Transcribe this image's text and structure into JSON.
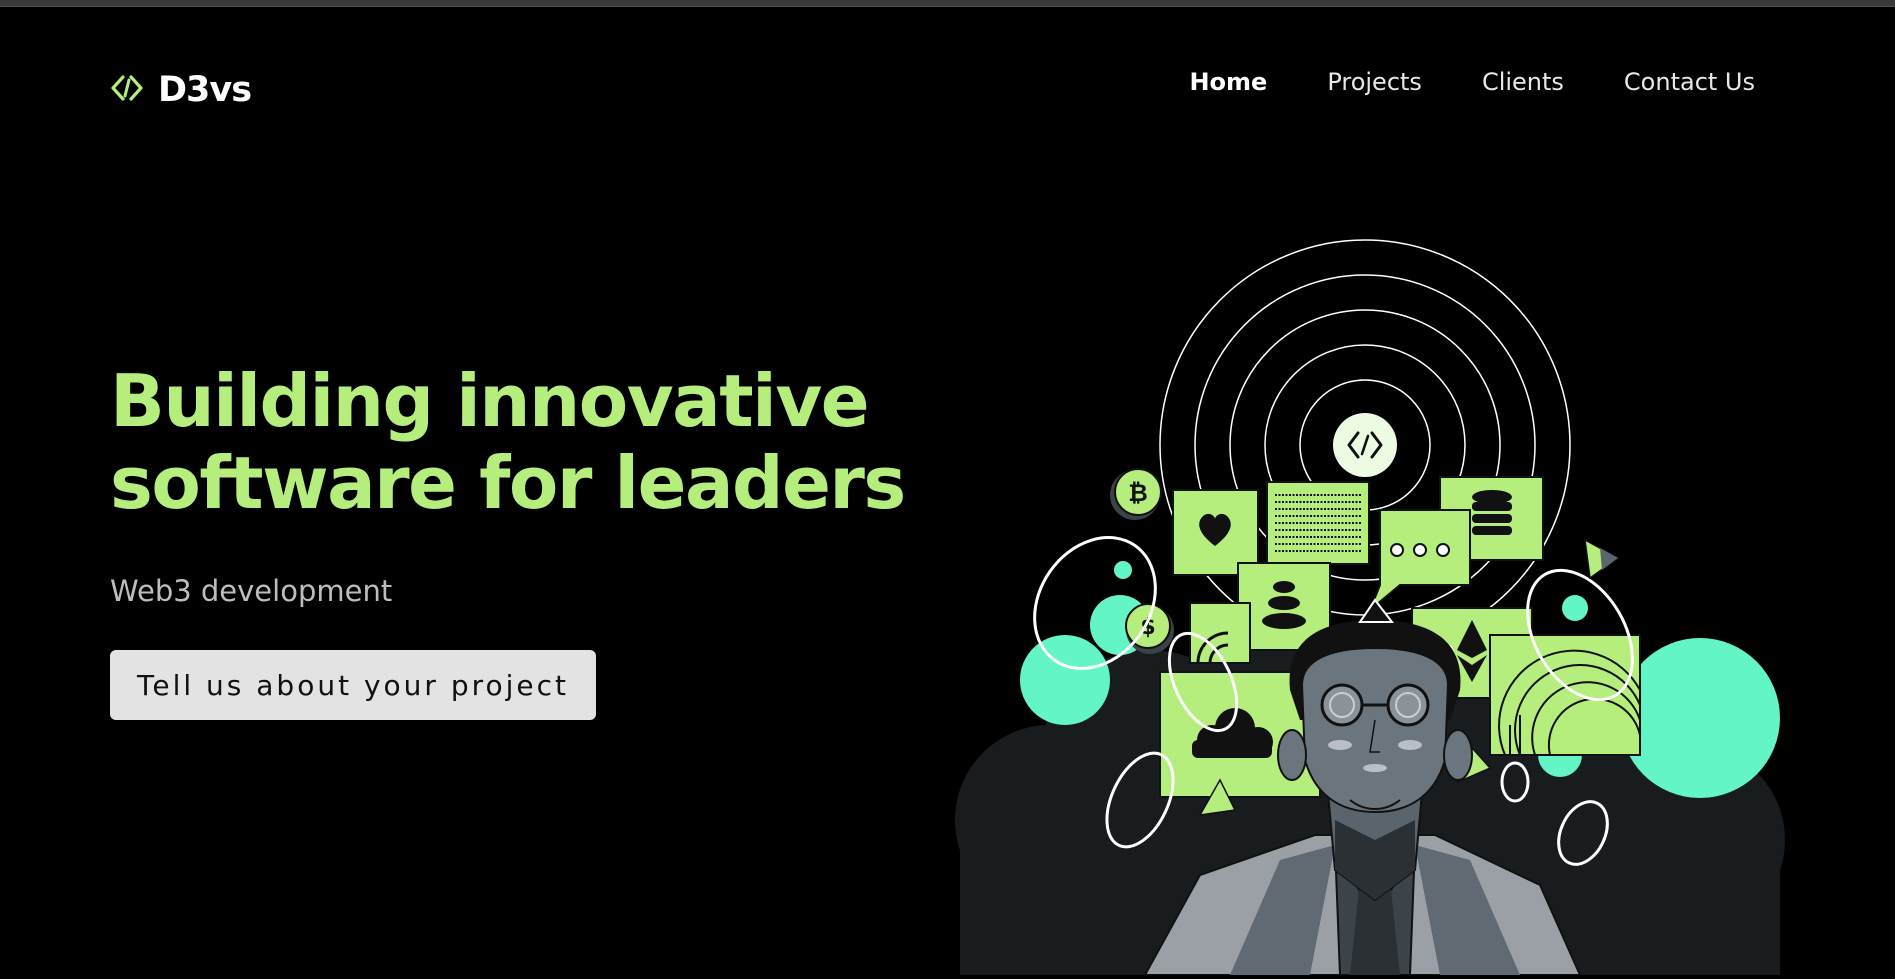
{
  "brand": {
    "name": "D3vs",
    "logo_icon": "code-diamond-icon",
    "accent_color": "#b5ee7d",
    "teal_color": "#63f5c6"
  },
  "nav": {
    "items": [
      {
        "label": "Home",
        "active": true
      },
      {
        "label": "Projects",
        "active": false
      },
      {
        "label": "Clients",
        "active": false
      },
      {
        "label": "Contact Us",
        "active": false
      }
    ]
  },
  "hero": {
    "headline_line1": "Building innovative",
    "headline_line2": "software for leaders",
    "subheadline": "Web3 development",
    "cta_label": "Tell us about your project"
  },
  "illustration": {
    "icons": [
      "heart-icon",
      "database-icon",
      "chat-bubble-icon",
      "coin-stack-icon",
      "ethereum-icon",
      "bitcoin-coin-icon",
      "dollar-coin-icon",
      "cloud-icon",
      "code-diamond-icon"
    ]
  }
}
